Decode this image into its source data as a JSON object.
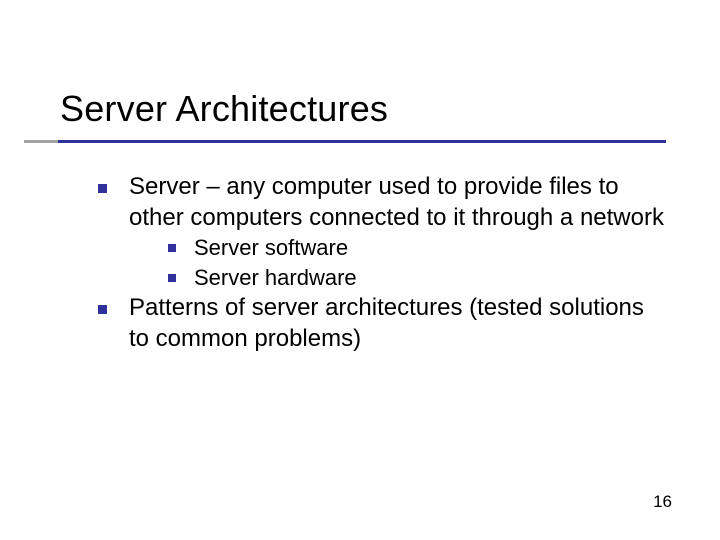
{
  "title": "Server Architectures",
  "bullets": [
    {
      "text": "Server – any computer used to provide files to other computers connected to it through a network",
      "sub": [
        "Server software",
        "Server hardware"
      ]
    },
    {
      "text": "Patterns of server architectures (tested solutions to common problems)",
      "sub": []
    }
  ],
  "page_number": "16",
  "colors": {
    "accent": "#31319c",
    "rule_short": "#a1a19f"
  }
}
